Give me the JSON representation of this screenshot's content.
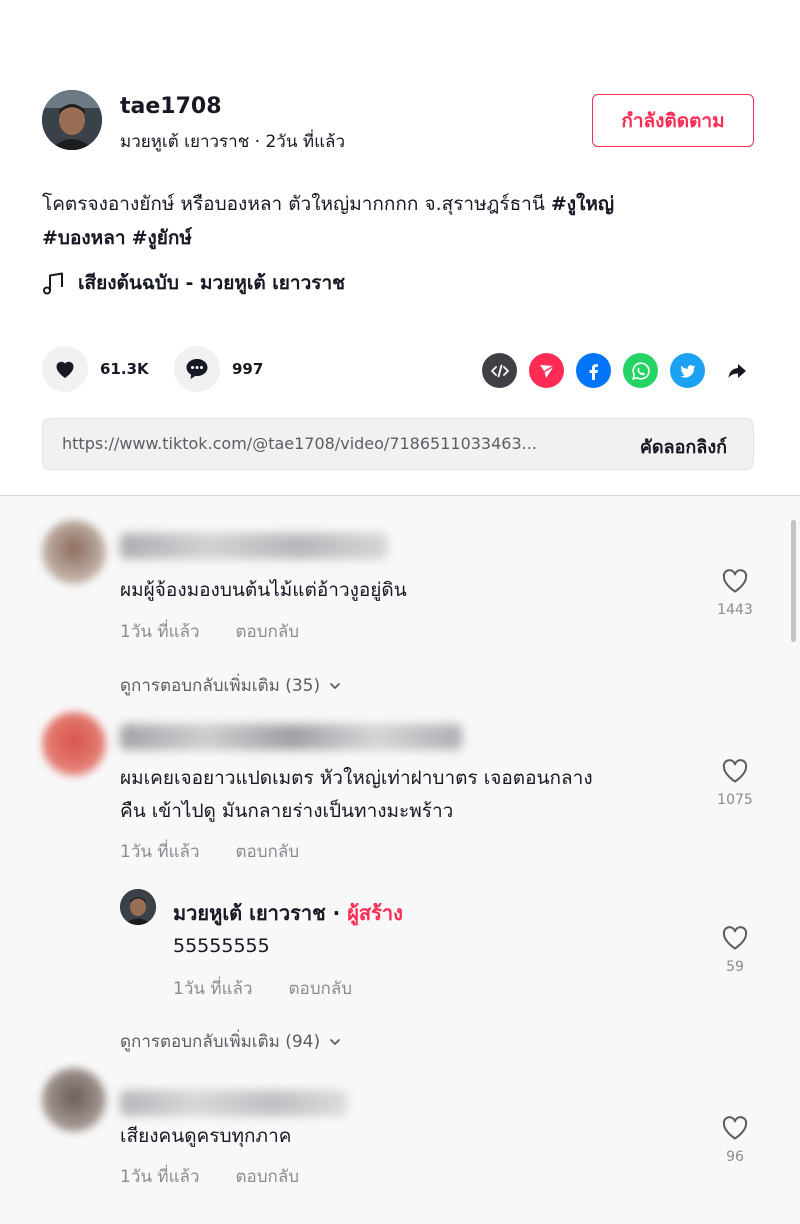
{
  "author": {
    "username": "tae1708",
    "nickname": "มวยหูเต้ เยาวราช",
    "posted": "2วัน ที่แล้ว",
    "follow_label": "กำลังติดตาม"
  },
  "caption": {
    "text": "โคตรจงอางยักษ์ หรือบองหลา ตัวใหญ่มากกกก จ.สุราษฎร์ธานี ",
    "tag1": "#งูใหญ่",
    "tag2": "#บองหลา",
    "tag3": "#งูยักษ์"
  },
  "music": "เสียงต้นฉบับ - มวยหูเต้ เยาวราช",
  "stats": {
    "likes": "61.3K",
    "comments": "997"
  },
  "share_icons": [
    "embed-icon",
    "send-icon",
    "facebook-icon",
    "whatsapp-icon",
    "twitter-icon",
    "share-arrow-icon"
  ],
  "colors": {
    "accent": "#fe2c55",
    "facebook": "#0075fa",
    "whatsapp": "#25d366",
    "twitter": "#1da1f2",
    "embed": "#3f4045"
  },
  "link": {
    "url": "https://www.tiktok.com/@tae1708/video/7186511033463...",
    "copy_label": "คัดลอกลิงก์"
  },
  "comments": [
    {
      "text": "ผมผู้จ้องมองบนต้นไม้แต่อ้าวงูอยู่ดิน",
      "time": "1วัน ที่แล้ว",
      "reply_label": "ตอบกลับ",
      "likes": "1443",
      "more_replies": "ดูการตอบกลับเพิ่มเติม (35)"
    },
    {
      "text_line1": "ผมเคยเจอยาวแปดเมตร หัวใหญ่เท่าฝาบาตร เจอตอนกลาง",
      "text_line2": "คืน เข้าไปดู มันกลายร่างเป็นทางมะพร้าว",
      "time": "1วัน ที่แล้ว",
      "reply_label": "ตอบกลับ",
      "likes": "1075",
      "reply": {
        "name": "มวยหูเต้ เยาวราช",
        "separator": " · ",
        "creator_label": "ผู้สร้าง",
        "text": "55555555",
        "time": "1วัน ที่แล้ว",
        "reply_label": "ตอบกลับ",
        "likes": "59"
      },
      "more_replies": "ดูการตอบกลับเพิ่มเติม (94)"
    },
    {
      "text": "เสียงคนดูครบทุกภาค",
      "time": "1วัน ที่แล้ว",
      "reply_label": "ตอบกลับ",
      "likes": "96"
    }
  ]
}
